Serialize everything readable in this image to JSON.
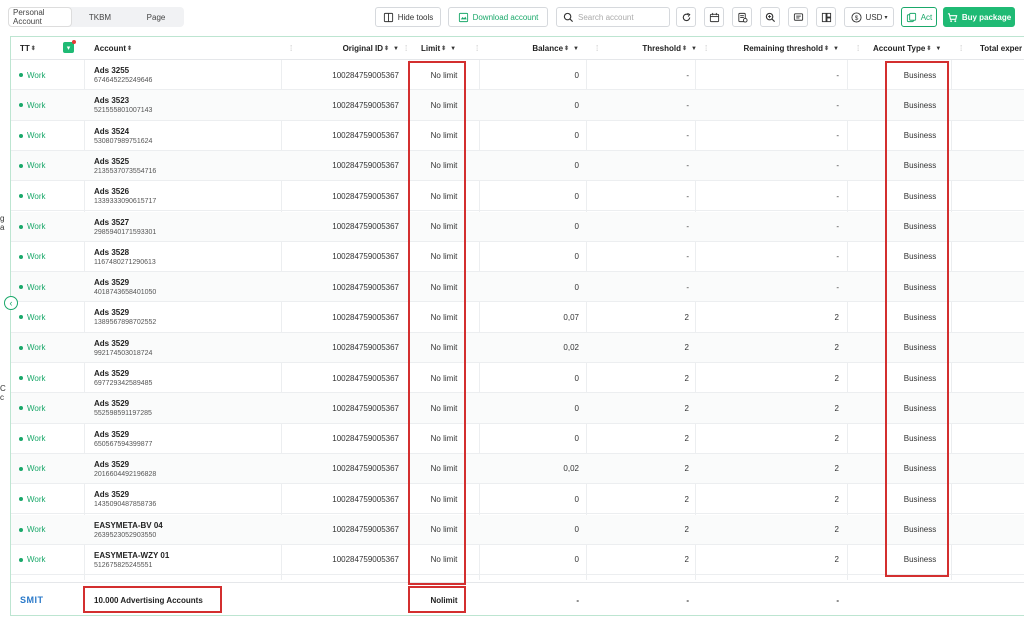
{
  "toolbar": {
    "tabs": [
      "Personal Account",
      "TKBM",
      "Page"
    ],
    "hide_tools": "Hide tools",
    "download_account": "Download account",
    "search_placeholder": "Search account",
    "currency": "USD",
    "act": "Act",
    "buy_package": "Buy package"
  },
  "columns": {
    "tt": "TT",
    "account": "Account",
    "original_id": "Original ID",
    "limit": "Limit",
    "balance": "Balance",
    "threshold": "Threshold",
    "remaining_threshold": "Remaining threshold",
    "account_type": "Account Type",
    "total_spend": "Total exper"
  },
  "rows": [
    {
      "status": "Work",
      "name": "Ads 3255",
      "acc_id": "674645225249646",
      "original_id": "100284759005367",
      "limit": "No limit",
      "balance": "0",
      "threshold": "-",
      "remaining": "-",
      "type": "Business"
    },
    {
      "status": "Work",
      "name": "Ads 3523",
      "acc_id": "521555801007143",
      "original_id": "100284759005367",
      "limit": "No limit",
      "balance": "0",
      "threshold": "-",
      "remaining": "-",
      "type": "Business"
    },
    {
      "status": "Work",
      "name": "Ads 3524",
      "acc_id": "530807989751624",
      "original_id": "100284759005367",
      "limit": "No limit",
      "balance": "0",
      "threshold": "-",
      "remaining": "-",
      "type": "Business"
    },
    {
      "status": "Work",
      "name": "Ads 3525",
      "acc_id": "2135537073554716",
      "original_id": "100284759005367",
      "limit": "No limit",
      "balance": "0",
      "threshold": "-",
      "remaining": "-",
      "type": "Business"
    },
    {
      "status": "Work",
      "name": "Ads 3526",
      "acc_id": "1339333090615717",
      "original_id": "100284759005367",
      "limit": "No limit",
      "balance": "0",
      "threshold": "-",
      "remaining": "-",
      "type": "Business"
    },
    {
      "status": "Work",
      "name": "Ads 3527",
      "acc_id": "2985940171593301",
      "original_id": "100284759005367",
      "limit": "No limit",
      "balance": "0",
      "threshold": "-",
      "remaining": "-",
      "type": "Business"
    },
    {
      "status": "Work",
      "name": "Ads 3528",
      "acc_id": "1167480271290613",
      "original_id": "100284759005367",
      "limit": "No limit",
      "balance": "0",
      "threshold": "-",
      "remaining": "-",
      "type": "Business"
    },
    {
      "status": "Work",
      "name": "Ads 3529",
      "acc_id": "4018743658401050",
      "original_id": "100284759005367",
      "limit": "No limit",
      "balance": "0",
      "threshold": "-",
      "remaining": "-",
      "type": "Business"
    },
    {
      "status": "Work",
      "name": "Ads 3529",
      "acc_id": "1389567898702552",
      "original_id": "100284759005367",
      "limit": "No limit",
      "balance": "0,07",
      "threshold": "2",
      "remaining": "2",
      "type": "Business"
    },
    {
      "status": "Work",
      "name": "Ads 3529",
      "acc_id": "992174503018724",
      "original_id": "100284759005367",
      "limit": "No limit",
      "balance": "0,02",
      "threshold": "2",
      "remaining": "2",
      "type": "Business"
    },
    {
      "status": "Work",
      "name": "Ads 3529",
      "acc_id": "697729342589485",
      "original_id": "100284759005367",
      "limit": "No limit",
      "balance": "0",
      "threshold": "2",
      "remaining": "2",
      "type": "Business"
    },
    {
      "status": "Work",
      "name": "Ads 3529",
      "acc_id": "552598591197285",
      "original_id": "100284759005367",
      "limit": "No limit",
      "balance": "0",
      "threshold": "2",
      "remaining": "2",
      "type": "Business"
    },
    {
      "status": "Work",
      "name": "Ads 3529",
      "acc_id": "650567594399877",
      "original_id": "100284759005367",
      "limit": "No limit",
      "balance": "0",
      "threshold": "2",
      "remaining": "2",
      "type": "Business"
    },
    {
      "status": "Work",
      "name": "Ads 3529",
      "acc_id": "2016604492196828",
      "original_id": "100284759005367",
      "limit": "No limit",
      "balance": "0,02",
      "threshold": "2",
      "remaining": "2",
      "type": "Business"
    },
    {
      "status": "Work",
      "name": "Ads 3529",
      "acc_id": "1435090487858736",
      "original_id": "100284759005367",
      "limit": "No limit",
      "balance": "0",
      "threshold": "2",
      "remaining": "2",
      "type": "Business"
    },
    {
      "status": "Work",
      "name": "EASYMETA-BV 04",
      "acc_id": "2639523052903550",
      "original_id": "100284759005367",
      "limit": "No limit",
      "balance": "0",
      "threshold": "2",
      "remaining": "2",
      "type": "Business"
    },
    {
      "status": "Work",
      "name": "EASYMETA-WZY 01",
      "acc_id": "512675825245551",
      "original_id": "100284759005367",
      "limit": "No limit",
      "balance": "0",
      "threshold": "2",
      "remaining": "2",
      "type": "Business"
    }
  ],
  "footer": {
    "logo": "SMIT",
    "total_accounts": "10.000 Advertising Accounts",
    "limit": "Nolimit",
    "balance": "-",
    "threshold": "-",
    "remaining": "-"
  },
  "left_strip": {
    "frag1": "g a",
    "frag2": "C c"
  },
  "colors": {
    "accent_green": "#1fba74",
    "highlight_red": "#d32f2f"
  }
}
